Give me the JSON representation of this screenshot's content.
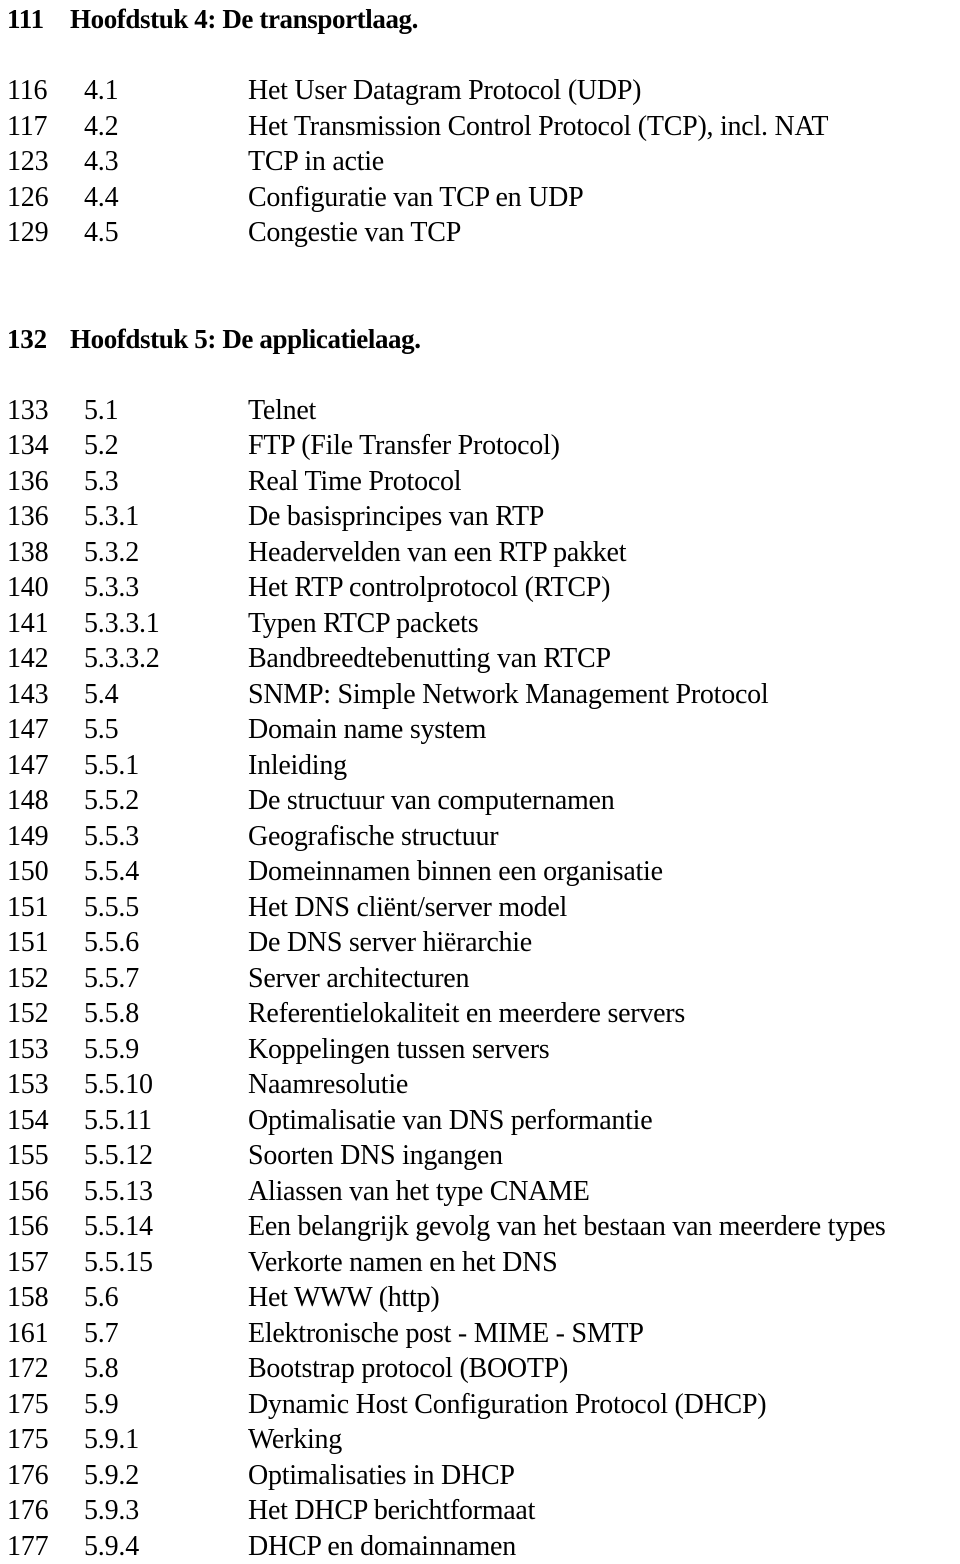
{
  "document": {
    "kind": "table-of-contents",
    "language": "nl"
  },
  "entries": [
    {
      "type": "chapter",
      "page": "111",
      "number": "",
      "title": "Hoofdstuk 4: De transportlaag."
    },
    {
      "type": "gap",
      "page": "",
      "number": "",
      "title": ""
    },
    {
      "type": "section",
      "page": "116",
      "number": "4.1",
      "title": "Het User Datagram Protocol (UDP)"
    },
    {
      "type": "section",
      "page": "117",
      "number": "4.2",
      "title": "Het Transmission Control Protocol (TCP), incl. NAT"
    },
    {
      "type": "section",
      "page": "123",
      "number": "4.3",
      "title": "TCP in actie"
    },
    {
      "type": "section",
      "page": "126",
      "number": "4.4",
      "title": "Configuratie van TCP en UDP"
    },
    {
      "type": "section",
      "page": "129",
      "number": "4.5",
      "title": "Congestie van TCP"
    },
    {
      "type": "gap",
      "page": "",
      "number": "",
      "title": ""
    },
    {
      "type": "gap",
      "page": "",
      "number": "",
      "title": ""
    },
    {
      "type": "chapter",
      "page": "132",
      "number": "",
      "title": "Hoofdstuk 5: De applicatielaag."
    },
    {
      "type": "gap",
      "page": "",
      "number": "",
      "title": ""
    },
    {
      "type": "section",
      "page": "133",
      "number": "5.1",
      "title": "Telnet"
    },
    {
      "type": "section",
      "page": "134",
      "number": "5.2",
      "title": "FTP (File Transfer Protocol)"
    },
    {
      "type": "section",
      "page": "136",
      "number": "5.3",
      "title": "Real Time Protocol"
    },
    {
      "type": "section",
      "page": "136",
      "number": "5.3.1",
      "title": "De basisprincipes van RTP"
    },
    {
      "type": "section",
      "page": "138",
      "number": "5.3.2",
      "title": "Headervelden van een RTP pakket"
    },
    {
      "type": "section",
      "page": "140",
      "number": "5.3.3",
      "title": "Het RTP controlprotocol (RTCP)"
    },
    {
      "type": "section",
      "page": "141",
      "number": "5.3.3.1",
      "title": "Typen RTCP packets"
    },
    {
      "type": "section",
      "page": "142",
      "number": "5.3.3.2",
      "title": "Bandbreedtebenutting van RTCP"
    },
    {
      "type": "section",
      "page": "143",
      "number": "5.4",
      "title": "SNMP: Simple Network Management Protocol"
    },
    {
      "type": "section",
      "page": "147",
      "number": "5.5",
      "title": "Domain name system"
    },
    {
      "type": "section",
      "page": "147",
      "number": "5.5.1",
      "title": "Inleiding"
    },
    {
      "type": "section",
      "page": "148",
      "number": "5.5.2",
      "title": "De structuur van computernamen"
    },
    {
      "type": "section",
      "page": "149",
      "number": "5.5.3",
      "title": "Geografische structuur"
    },
    {
      "type": "section",
      "page": "150",
      "number": "5.5.4",
      "title": "Domeinnamen binnen een organisatie"
    },
    {
      "type": "section",
      "page": "151",
      "number": "5.5.5",
      "title": "Het DNS cliënt/server model"
    },
    {
      "type": "section",
      "page": "151",
      "number": "5.5.6",
      "title": "De DNS server hiërarchie"
    },
    {
      "type": "section",
      "page": "152",
      "number": "5.5.7",
      "title": "Server architecturen"
    },
    {
      "type": "section",
      "page": "152",
      "number": "5.5.8",
      "title": "Referentielokaliteit en meerdere servers"
    },
    {
      "type": "section",
      "page": "153",
      "number": "5.5.9",
      "title": "Koppelingen tussen servers"
    },
    {
      "type": "section",
      "page": "153",
      "number": "5.5.10",
      "title": "Naamresolutie"
    },
    {
      "type": "section",
      "page": "154",
      "number": "5.5.11",
      "title": "Optimalisatie van DNS performantie"
    },
    {
      "type": "section",
      "page": "155",
      "number": "5.5.12",
      "title": "Soorten DNS ingangen"
    },
    {
      "type": "section",
      "page": "156",
      "number": "5.5.13",
      "title": "Aliassen van het type CNAME"
    },
    {
      "type": "section",
      "page": "156",
      "number": "5.5.14",
      "title": "Een belangrijk gevolg van het bestaan van meerdere types"
    },
    {
      "type": "section",
      "page": "157",
      "number": "5.5.15",
      "title": "Verkorte namen en het DNS"
    },
    {
      "type": "section",
      "page": "158",
      "number": "5.6",
      "title": "Het WWW (http)"
    },
    {
      "type": "section",
      "page": "161",
      "number": "5.7",
      "title": "Elektronische post - MIME - SMTP"
    },
    {
      "type": "section",
      "page": "172",
      "number": "5.8",
      "title": "Bootstrap protocol (BOOTP)"
    },
    {
      "type": "section",
      "page": "175",
      "number": "5.9",
      "title": "Dynamic Host Configuration Protocol (DHCP)"
    },
    {
      "type": "section",
      "page": "175",
      "number": "5.9.1",
      "title": "Werking"
    },
    {
      "type": "section",
      "page": "176",
      "number": "5.9.2",
      "title": "Optimalisaties in DHCP"
    },
    {
      "type": "section",
      "page": "176",
      "number": "5.9.3",
      "title": "Het DHCP berichtformaat"
    },
    {
      "type": "section",
      "page": "177",
      "number": "5.9.4",
      "title": "DHCP en domainnamen"
    }
  ]
}
